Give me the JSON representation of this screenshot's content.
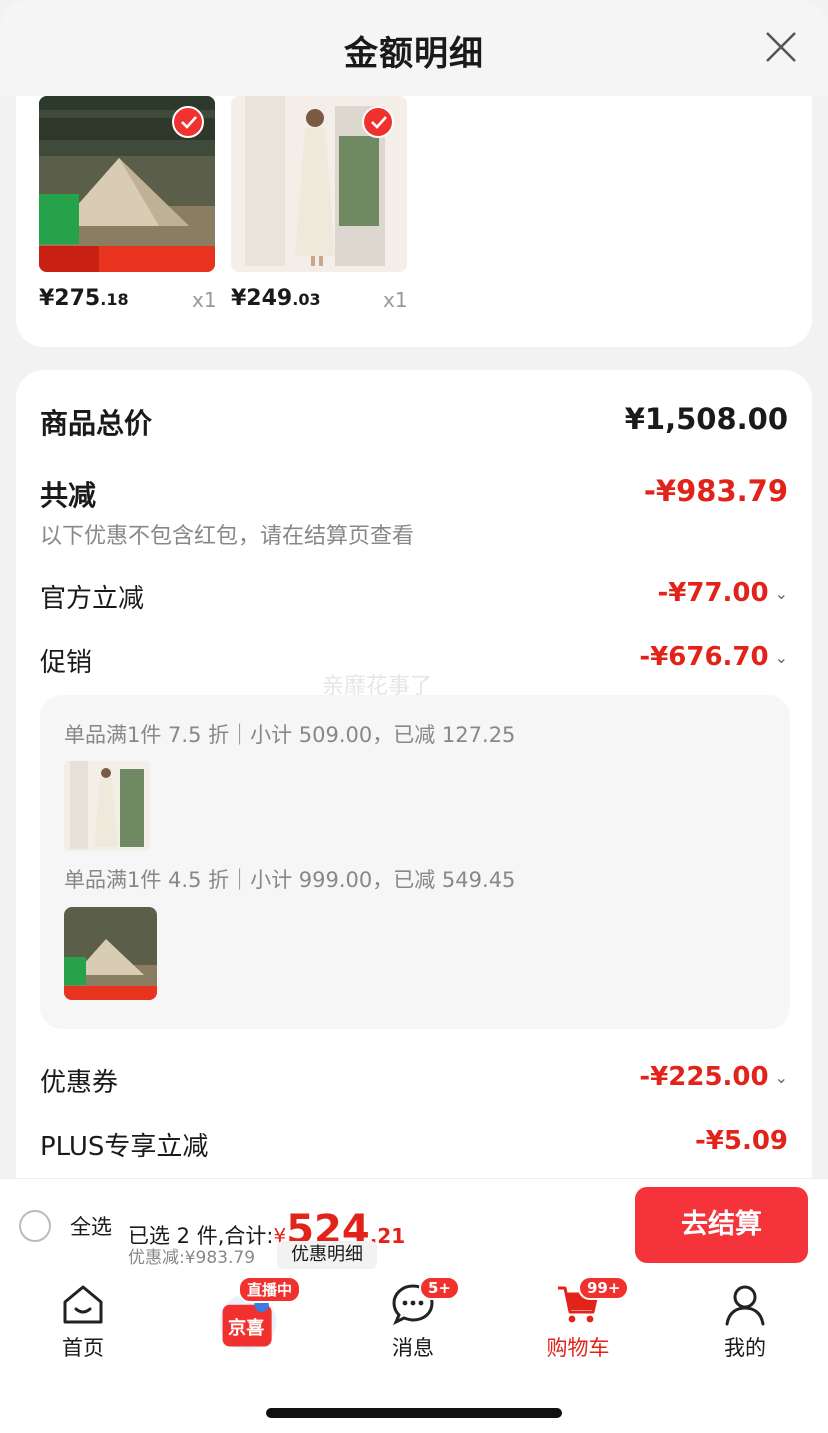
{
  "header": {
    "title": "金额明细"
  },
  "products": [
    {
      "price_int": "¥275",
      "price_dec": ".18",
      "qty": "x1"
    },
    {
      "price_int": "¥249",
      "price_dec": ".03",
      "qty": "x1"
    }
  ],
  "summary": {
    "total_label": "商品总价",
    "total_value": "¥1,508.00",
    "reduce_label": "共减",
    "reduce_value": "-¥983.79",
    "reduce_note": "以下优惠不包含红包，请在结算页查看",
    "official_label": "官方立减",
    "official_value": "-¥77.00",
    "promo_label": "促销",
    "promo_value": "-¥676.70",
    "promo_rules": [
      "单品满1件 7.5 折｜小计 509.00，已减 127.25",
      "单品满1件 4.5 折｜小计 999.00，已减 549.45"
    ],
    "coupon_label": "优惠券",
    "coupon_value": "-¥225.00",
    "plus_label": "PLUS专享立减",
    "plus_value": "-¥5.09",
    "watermark": "亲靡花事了"
  },
  "bottom": {
    "select_all": "全选",
    "selected_text": "已选 2 件,合计:",
    "total_yen": "¥",
    "total_int": "524",
    "total_dec": ".21",
    "discount_text": "优惠减:¥983.79",
    "detail_chip": "优惠明细",
    "checkout": "去结算"
  },
  "tabs": [
    {
      "label": "首页",
      "icon": "home-icon"
    },
    {
      "label": "京喜",
      "icon": "jingxi-icon",
      "badge": "直播中"
    },
    {
      "label": "消息",
      "icon": "message-icon",
      "badge": "5+"
    },
    {
      "label": "购物车",
      "icon": "cart-icon",
      "badge": "99+",
      "active": true
    },
    {
      "label": "我的",
      "icon": "profile-icon"
    }
  ],
  "colors": {
    "accent": "#e2231a",
    "checkout": "#f4333a"
  }
}
